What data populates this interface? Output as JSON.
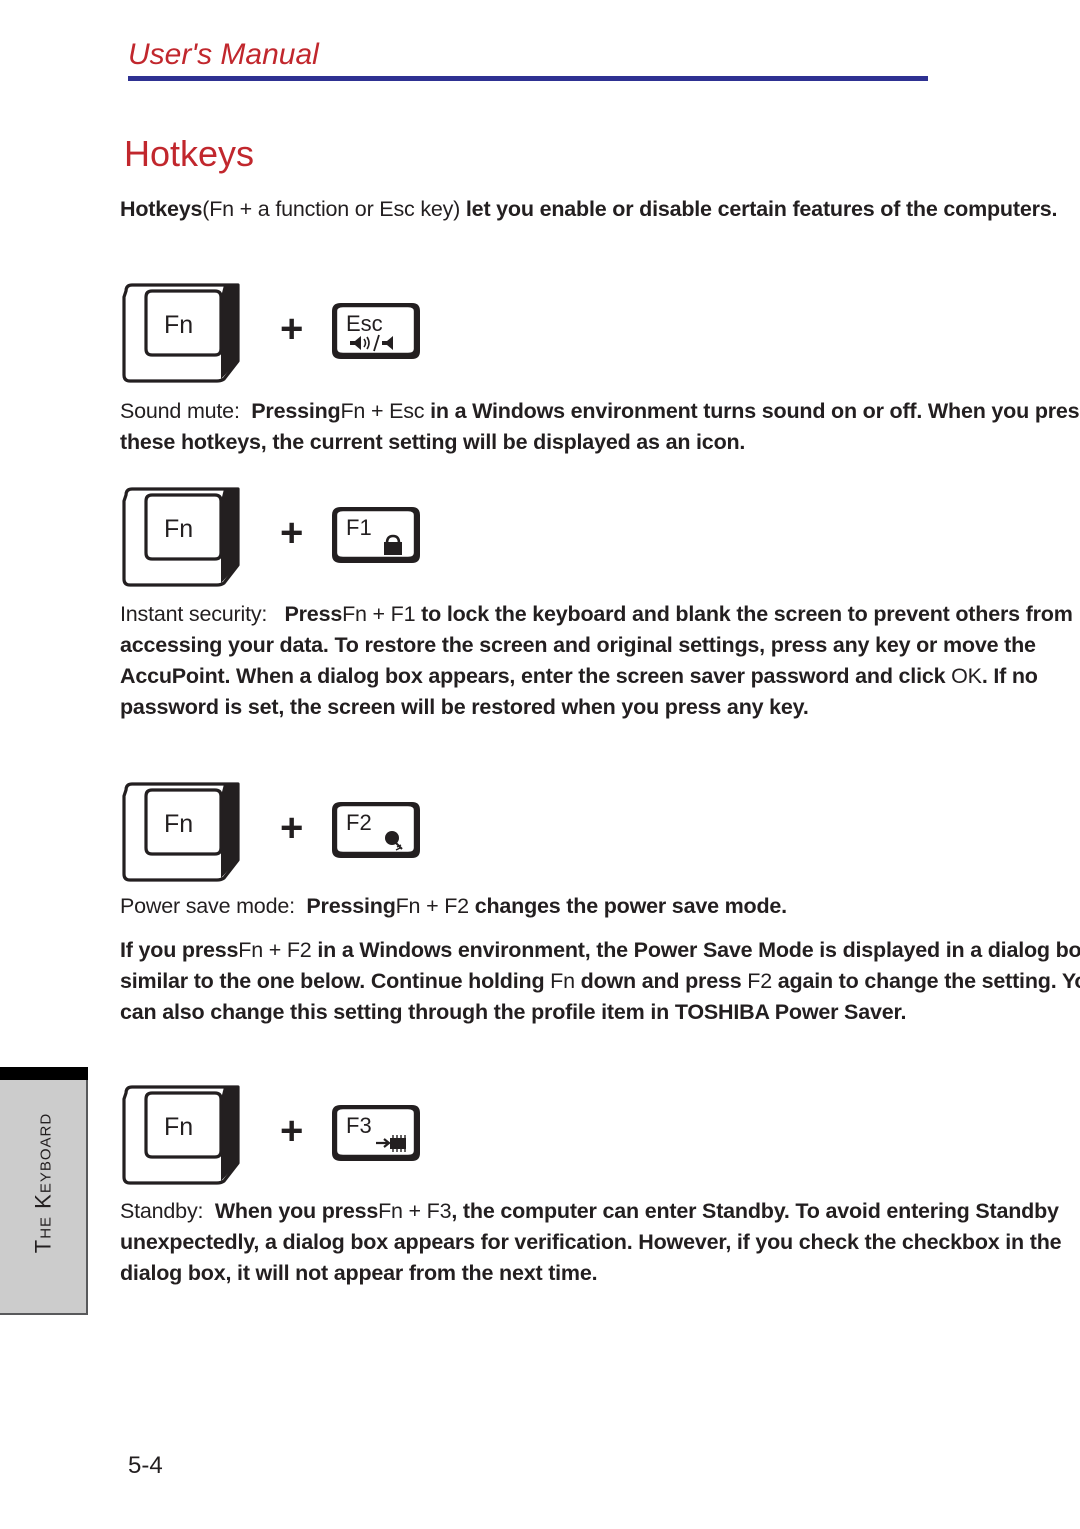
{
  "header": {
    "running_head": "User's Manual",
    "rule_color": "#2e3192",
    "accent_color": "#c1272d"
  },
  "page_title": "Hotkeys",
  "intro": {
    "lead": "Hotkeys",
    "paren": "(Fn + a function or Esc key)",
    "rest": " let you enable or disable certain features of the computers."
  },
  "sections": [
    {
      "id": "sound-mute",
      "keys": {
        "modifier_label": "Fn",
        "plus": "+",
        "function_label": "Esc",
        "function_icon": "speaker-mute-icon"
      },
      "label": "Sound mute:",
      "body_a": "Pressing",
      "combo": "Fn + Esc",
      "body_b": " in a Windows environment turns sound on or off. When you press these hotkeys, the current setting will be displayed as an icon."
    },
    {
      "id": "instant-security",
      "keys": {
        "modifier_label": "Fn",
        "plus": "+",
        "function_label": "F1",
        "function_icon": "padlock-icon"
      },
      "label": "Instant security:",
      "body_a": "Press",
      "combo": "Fn + F1",
      "body_b": " to lock the keyboard and blank the screen to prevent others from accessing your data. To restore the screen and original settings, press any key or move the AccuPoint. When a dialog box appears, enter the screen saver password and click ",
      "inline_button": "OK",
      "body_c": ". If no password is set, the screen will be restored when you press any key."
    },
    {
      "id": "power-save-mode",
      "keys": {
        "modifier_label": "Fn",
        "plus": "+",
        "function_label": "F2",
        "function_icon": "power-save-icon"
      },
      "label": "Power save mode:",
      "body_a": "Pressing",
      "combo": "Fn + F2",
      "body_b": " changes the power save mode.",
      "body_c_a": "If you press",
      "combo2": "Fn + F2",
      "body_c_b": " in a Windows environment, the Power Save Mode is displayed in a dialog box similar to the one below. Continue holding ",
      "key_fn": "Fn",
      "body_c_c": " down and press ",
      "key_f2": "F2",
      "body_c_d": " again to change the setting. You can also change this setting through the profile item in TOSHIBA Power Saver."
    },
    {
      "id": "standby",
      "keys": {
        "modifier_label": "Fn",
        "plus": "+",
        "function_label": "F3",
        "function_icon": "standby-chip-icon"
      },
      "label": "Standby:",
      "body_a": "When you press",
      "combo": "Fn + F3",
      "body_b": ", the computer can enter Standby. To avoid entering Standby unexpectedly, a dialog box appears for verification. However, if you check the checkbox in the dialog box, it will not appear from the next time."
    }
  ],
  "thumb_tab": {
    "label": "The Keyboard"
  },
  "folio": "5-4"
}
